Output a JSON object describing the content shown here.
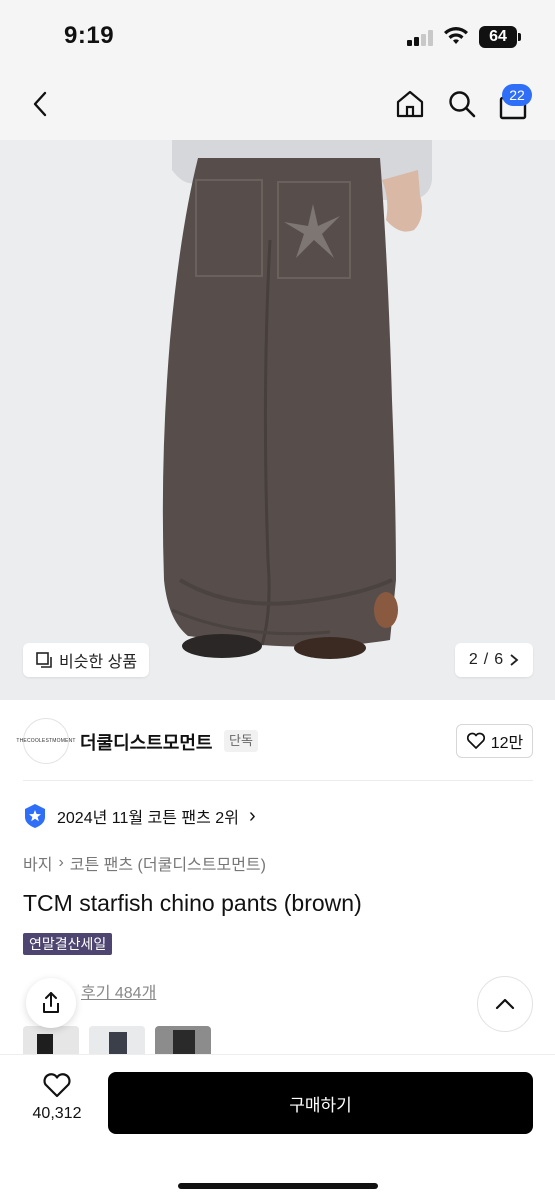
{
  "status_bar": {
    "time": "9:19",
    "battery": "64"
  },
  "nav": {
    "back_icon": "chevron-left-icon",
    "home_icon": "home-icon",
    "search_icon": "search-icon",
    "cart_icon": "bag-icon",
    "cart_count": "22"
  },
  "image": {
    "similar_label": "비슷한 상품",
    "page_current": "2",
    "page_total": "6",
    "page_separator": "/"
  },
  "brand": {
    "logo_text": "THECOOLESTMOMENT",
    "name": "더쿨디스트모먼트",
    "badge": "단독",
    "likes": "12만"
  },
  "ranking": {
    "text": "2024년 11월 코튼 팬츠 2위",
    "chevron": "›"
  },
  "breadcrumb": {
    "level1": "바지",
    "sep": "›",
    "level2": "코튼 팬츠 (더쿨디스트모먼트)"
  },
  "product": {
    "title": "TCM starfish chino pants (brown)",
    "sale_tag": "연말결산세일",
    "review_link": "후기 484개"
  },
  "bottom": {
    "wish_count": "40,312",
    "buy_label": "구매하기"
  },
  "colors": {
    "accent_badge": "#2f6ef6",
    "sale_tag_bg": "#4e4670",
    "pants_brown": "#574e4b",
    "buy_button": "#000000"
  }
}
